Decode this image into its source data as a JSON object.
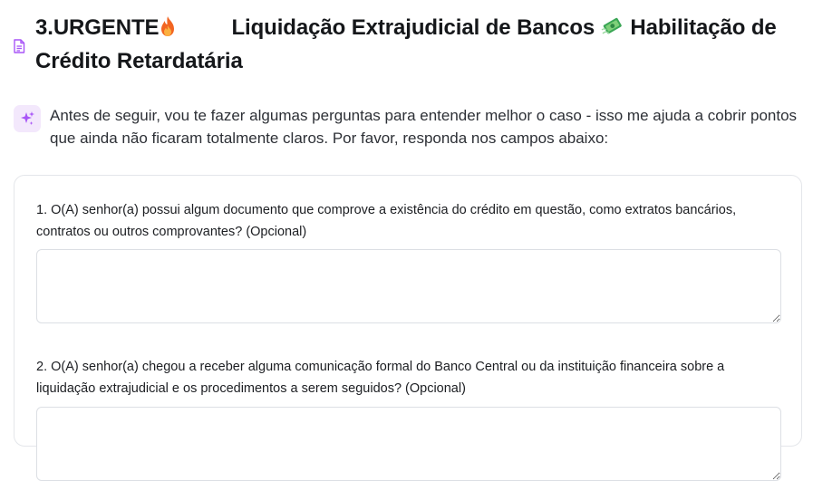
{
  "header": {
    "title_part1": "3.URGENTE",
    "fire_icon": "fire-emoji-icon",
    "title_part2": "Liquidação Extrajudicial de Bancos",
    "money_icon": "money-with-wings-emoji-icon",
    "title_part3": "Habilitação de Crédito Retardatária",
    "doc_icon": "document-icon"
  },
  "assistant": {
    "icon": "sparkles-icon",
    "message": "Antes de seguir, vou te fazer algumas perguntas para entender melhor o caso - isso me ajuda a cobrir pontos que ainda não ficaram totalmente claros. Por favor, responda nos campos abaixo:"
  },
  "questions": [
    {
      "label": "1. O(A) senhor(a) possui algum documento que comprove a existência do crédito em questão, como extratos bancários, contratos ou outros comprovantes? (Opcional)",
      "value": "",
      "placeholder": ""
    },
    {
      "label": "2. O(A) senhor(a) chegou a receber alguma comunicação formal do Banco Central ou da instituição financeira sobre a liquidação extrajudicial e os procedimentos a serem seguidos? (Opcional)",
      "value": "",
      "placeholder": ""
    }
  ],
  "colors": {
    "accent_purple": "#a855f7",
    "icon_bg": "#f3e8fc",
    "card_border": "#e4e6ea"
  }
}
